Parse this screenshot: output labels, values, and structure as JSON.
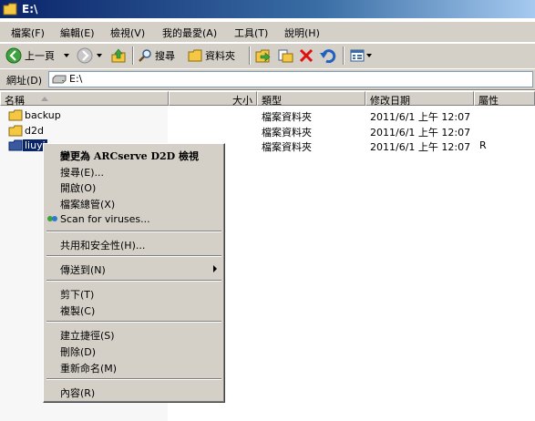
{
  "window": {
    "title": "E:\\"
  },
  "menubar": [
    {
      "label": "檔案(F)"
    },
    {
      "label": "編輯(E)"
    },
    {
      "label": "檢視(V)"
    },
    {
      "label": "我的最愛(A)"
    },
    {
      "label": "工具(T)"
    },
    {
      "label": "說明(H)"
    }
  ],
  "toolbar": {
    "back_label": "上一頁",
    "search_label": "搜尋",
    "folders_label": "資料夾"
  },
  "address": {
    "label": "網址(D)",
    "value": "E:\\"
  },
  "columns": {
    "name": "名稱",
    "size": "大小",
    "type": "類型",
    "modified": "修改日期",
    "attributes": "屬性"
  },
  "files": [
    {
      "name": "backup",
      "type": "檔案資料夾",
      "modified": "2011/6/1 上午 12:07",
      "attr": ""
    },
    {
      "name": "d2d",
      "type": "檔案資料夾",
      "modified": "2011/6/1 上午 12:07",
      "attr": ""
    },
    {
      "name": "liuyi",
      "type": "檔案資料夾",
      "modified": "2011/6/1 上午 12:07",
      "attr": "R"
    }
  ],
  "context_menu": {
    "default_item": "變更為 ARCserve D2D 檢視",
    "search": "搜尋(E)...",
    "open": "開啟(O)",
    "explore": "檔案總管(X)",
    "scan": "Scan for viruses...",
    "sharing": "共用和安全性(H)...",
    "send_to": "傳送到(N)",
    "cut": "剪下(T)",
    "copy": "複製(C)",
    "create_shortcut": "建立捷徑(S)",
    "delete": "刪除(D)",
    "rename": "重新命名(M)",
    "properties": "內容(R)"
  },
  "colors": {
    "title_bar": "#0a246a",
    "face": "#d4d0c8",
    "selection": "#0a246a",
    "folder": "#f4c842"
  }
}
